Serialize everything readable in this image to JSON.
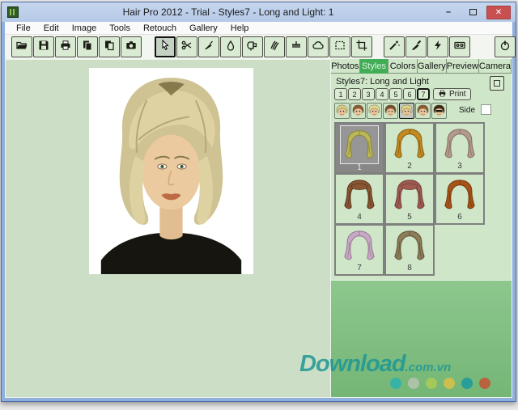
{
  "window": {
    "title": "Hair Pro 2012 - Trial - Styles7 - Long and Light: 1",
    "controls": {
      "minimize": "–",
      "close": "✕"
    }
  },
  "menu": {
    "items": [
      "File",
      "Edit",
      "Image",
      "Tools",
      "Retouch",
      "Gallery",
      "Help"
    ]
  },
  "toolbar": {
    "groups": [
      {
        "buttons": [
          {
            "icon": "open-folder"
          },
          {
            "icon": "save"
          },
          {
            "icon": "print"
          },
          {
            "icon": "copy"
          },
          {
            "icon": "paste"
          },
          {
            "icon": "camera"
          }
        ]
      },
      {
        "buttons": [
          {
            "icon": "pointer",
            "selected": true
          },
          {
            "icon": "scissors"
          },
          {
            "icon": "eyedropper"
          },
          {
            "icon": "droplet"
          },
          {
            "icon": "hairdryer"
          },
          {
            "icon": "hair-strands"
          },
          {
            "icon": "comb"
          },
          {
            "icon": "lasso-cloud"
          },
          {
            "icon": "rect-select"
          },
          {
            "icon": "crop"
          }
        ]
      },
      {
        "buttons": [
          {
            "icon": "magic-wand"
          },
          {
            "icon": "brush"
          },
          {
            "icon": "lightning"
          },
          {
            "icon": "cassette"
          }
        ]
      },
      {
        "buttons": [
          {
            "icon": "power"
          }
        ]
      }
    ]
  },
  "panel": {
    "tabs": [
      {
        "label": "Photos"
      },
      {
        "label": "Styles",
        "selected": true
      },
      {
        "label": "Colors"
      },
      {
        "label": "Gallery"
      },
      {
        "label": "Preview"
      },
      {
        "label": "Camera"
      }
    ],
    "styles_section": {
      "header": "Styles7: Long and Light",
      "page_buttons": [
        "1",
        "2",
        "3",
        "4",
        "5",
        "6",
        "7"
      ],
      "selected_page": "7",
      "print_label": "Print",
      "side_label": "Side",
      "side_checked": false,
      "faces": [
        {
          "hair": "#d6cc86"
        },
        {
          "hair": "#8a5c34"
        },
        {
          "hair": "#e2d890"
        },
        {
          "hair": "#7a4e2c"
        },
        {
          "hair": "#ded688",
          "selected": true
        },
        {
          "hair": "#8a5c34"
        },
        {
          "hair": "#3a2a16",
          "sunglasses": true
        }
      ],
      "styles": [
        {
          "number": "1",
          "color": "#bdb75c",
          "shade": "#8e8838",
          "variant": "parted",
          "selected": true
        },
        {
          "number": "2",
          "color": "#c28a20",
          "shade": "#8f6312",
          "variant": "parted"
        },
        {
          "number": "3",
          "color": "#b29a8e",
          "shade": "#8a7265",
          "variant": "parted"
        },
        {
          "number": "4",
          "color": "#8a5632",
          "shade": "#5e3a20",
          "variant": "bangs"
        },
        {
          "number": "5",
          "color": "#a05a50",
          "shade": "#744038",
          "variant": "bangs"
        },
        {
          "number": "6",
          "color": "#a85418",
          "shade": "#7a3c0e",
          "variant": "parted"
        },
        {
          "number": "7",
          "color": "#c8a8c4",
          "shade": "#9a7e96",
          "variant": "parted"
        },
        {
          "number": "8",
          "color": "#8c7c58",
          "shade": "#645838",
          "variant": "parted"
        }
      ]
    }
  },
  "portrait": {
    "bg": "#ffffff",
    "hair": "#cfc293",
    "hair_light": "#ded2a2",
    "hair_dark": "#6d6134",
    "skin": "#eccaa0",
    "skin_shade": "#e2bd92",
    "top": "#17150f",
    "lips": "#bd6a45"
  },
  "watermark": {
    "text_main": "Download",
    "text_suffix": ".com.vn",
    "color": "#1e9694",
    "dots": [
      "#2fb3ab",
      "#b2c3ae",
      "#a6cb55",
      "#d6bf4a",
      "#1f9b9d",
      "#bf5a37"
    ]
  },
  "theme": {
    "titlebar_bg": "#b5c9e7",
    "frame": "#8fafdc",
    "canvas_bg": "#ccdfc6",
    "panel_bg": "#cfe6c9",
    "tab_selected_bg": "#41ad56",
    "button_bg": "#d9ecd3",
    "close_bg": "#c85050"
  }
}
